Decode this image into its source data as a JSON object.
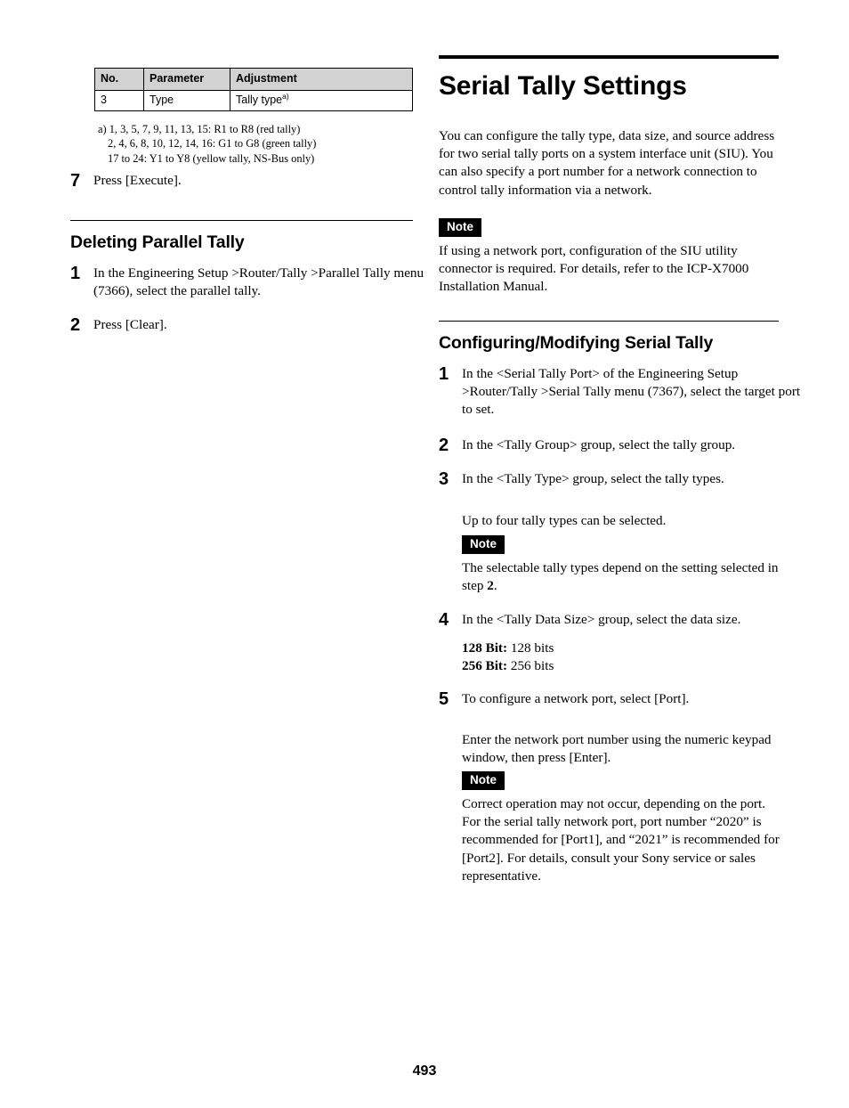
{
  "table": {
    "headers": [
      "No.",
      "Parameter",
      "Adjustment"
    ],
    "rows": [
      {
        "no": "3",
        "parameter": "Type",
        "adjustment": "Tally type",
        "adjustment_sup": "a)"
      }
    ]
  },
  "footnote": {
    "line1": "a) 1, 3, 5, 7, 9, 11, 13, 15: R1 to R8 (red tally)",
    "line2": "2, 4, 6, 8, 10, 12, 14, 16: G1 to G8 (green tally)",
    "line3": "17 to 24: Y1 to Y8 (yellow tally, NS-Bus only)"
  },
  "left_column": {
    "step7": {
      "num": "7",
      "text": "Press [Execute]."
    },
    "heading": "Deleting Parallel Tally",
    "step1": {
      "num": "1",
      "text": "In the Engineering Setup >Router/Tally >Parallel Tally menu (7366), select the parallel tally."
    },
    "step2": {
      "num": "2",
      "text": "Press [Clear]."
    }
  },
  "right_column": {
    "title": "Serial Tally Settings",
    "intro": "You can configure the tally type, data size, and source address for two serial tally ports on a system interface unit (SIU). You can also specify a port number for a network connection to control tally information via a network.",
    "note1": {
      "label": "Note",
      "text": "If using a network port, configuration of the SIU utility connector is required. For details, refer to the ICP-X7000 Installation Manual."
    },
    "subsection": "Configuring/Modifying Serial Tally",
    "step1": {
      "num": "1",
      "text": "In the <Serial Tally Port> of the Engineering Setup >Router/Tally >Serial Tally menu (7367), select the target port to set."
    },
    "step2": {
      "num": "2",
      "text": "In the <Tally Group> group, select the tally group."
    },
    "step3": {
      "num": "3",
      "text": "In the <Tally Type> group, select the tally types.",
      "extra": "Up to four tally types can be selected.",
      "note": {
        "label": "Note",
        "text_before": "The selectable tally types depend on the setting selected in step ",
        "text_bold": "2",
        "text_after": "."
      }
    },
    "step4": {
      "num": "4",
      "text": "In the <Tally Data Size> group, select the data size.",
      "options": [
        {
          "label": "128 Bit:",
          "value": "128 bits"
        },
        {
          "label": "256 Bit:",
          "value": "256 bits"
        }
      ]
    },
    "step5": {
      "num": "5",
      "text": "To configure a network port, select [Port].",
      "extra": "Enter the network port number using the numeric keypad window, then press [Enter].",
      "note": {
        "label": "Note",
        "line1": "Correct operation may not occur, depending on the port.",
        "line2": "For the serial tally network port, port number “2020” is recommended for [Port1], and “2021” is recommended for [Port2]. For details, consult your Sony service or sales representative."
      }
    }
  },
  "footer": {
    "page_number": "493"
  }
}
